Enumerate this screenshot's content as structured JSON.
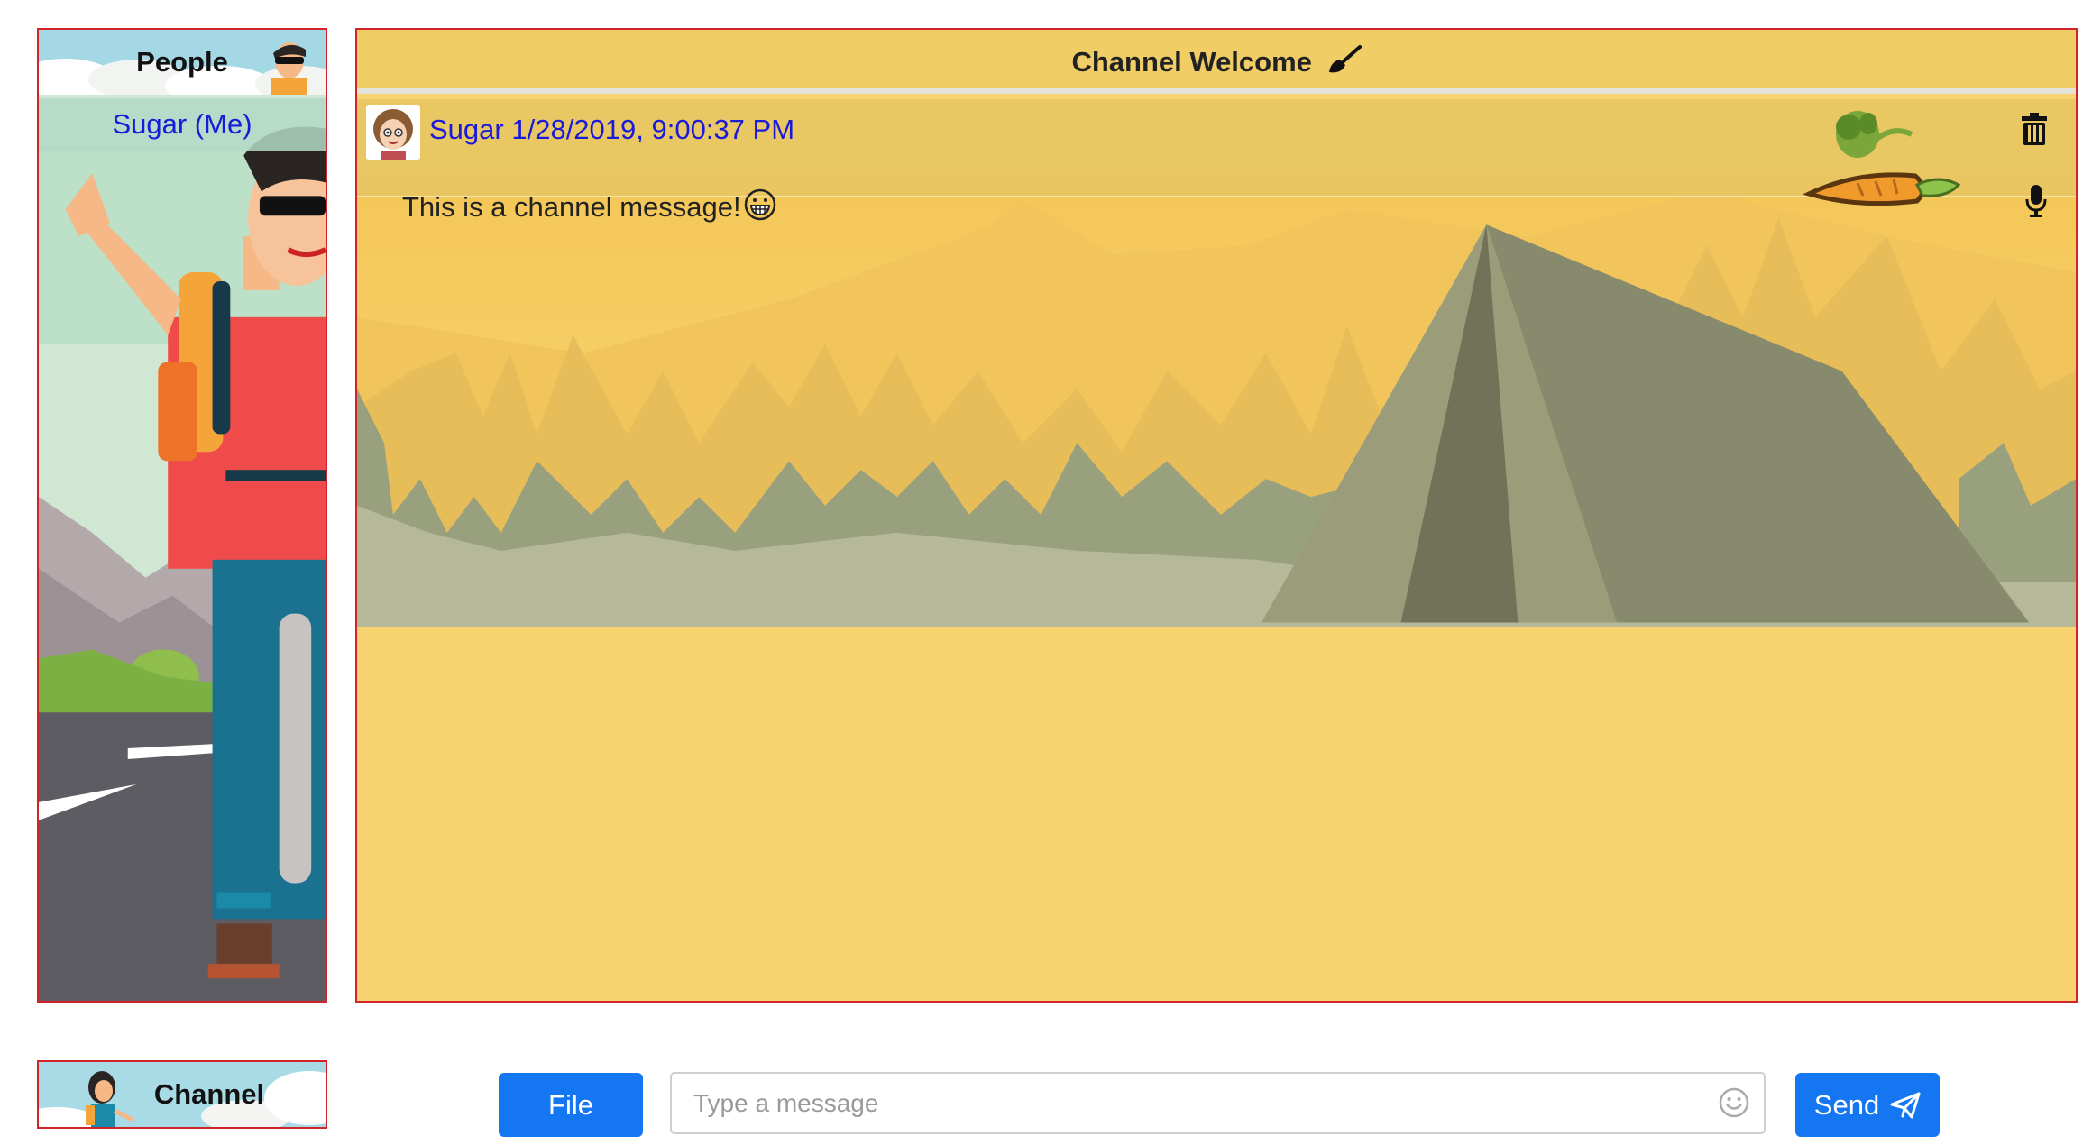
{
  "people": {
    "title": "People",
    "items": [
      {
        "label": "Sugar (Me)"
      }
    ]
  },
  "channel": {
    "title": "Channel Welcome",
    "title_icon": "brush-icon",
    "messages": [
      {
        "author": "Sugar",
        "timestamp": "1/28/2019, 9:00:37 PM",
        "text": "This is a channel message!",
        "emoji": "grinning-face-icon",
        "reaction": "carrot-icon"
      }
    ]
  },
  "channel_tab": {
    "label": "Channel"
  },
  "composer": {
    "file_label": "File",
    "placeholder": "Type a message",
    "send_label": "Send"
  },
  "colors": {
    "accent": "#1476f0",
    "panel_border": "#d0232a",
    "channel_bg": "#f8d36f",
    "link_text": "#1a1adb"
  }
}
